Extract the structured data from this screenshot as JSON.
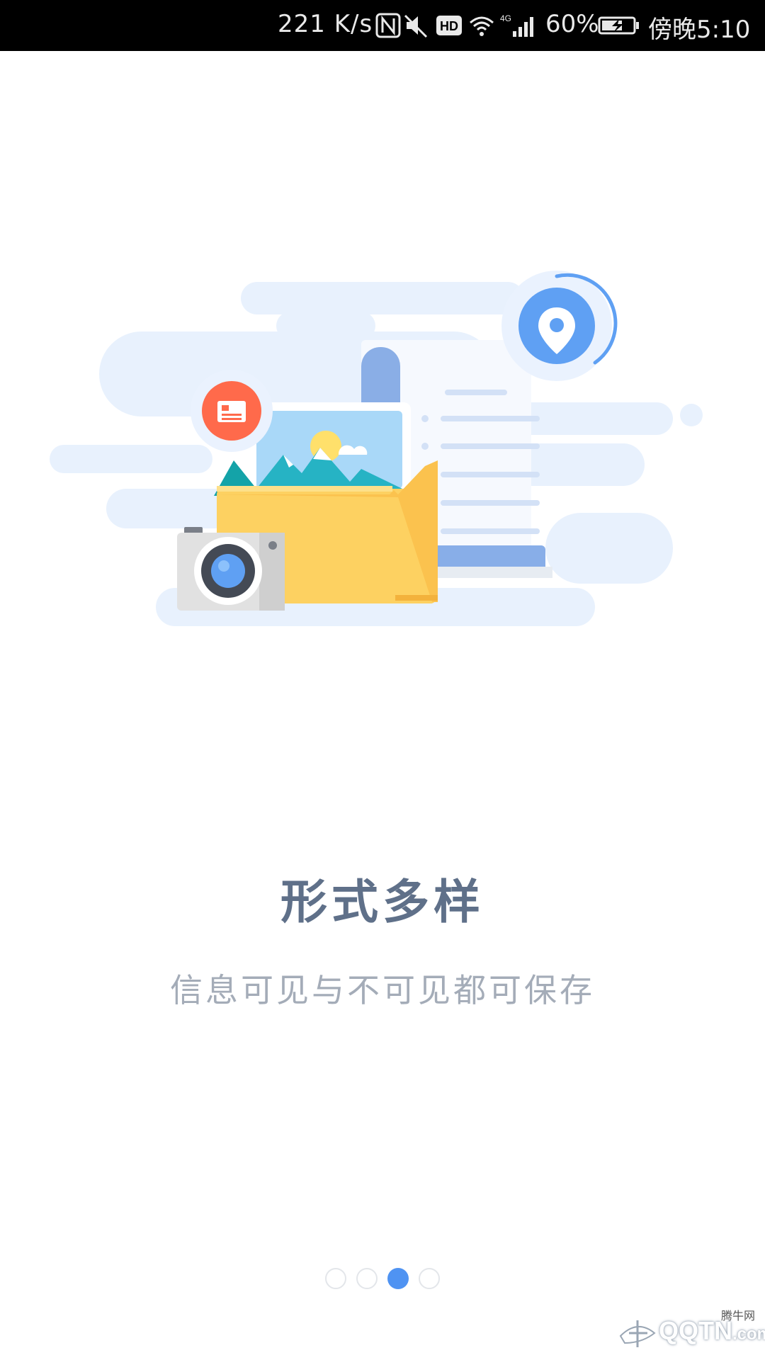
{
  "status_bar": {
    "net_speed": "221 K/s",
    "battery_percent": "60%",
    "time": "傍晚5:10",
    "icons": [
      "nfc-icon",
      "mute-icon",
      "hd-icon",
      "wifi-icon",
      "signal-4g-icon",
      "battery-charging-icon"
    ]
  },
  "onboarding": {
    "title": "形式多样",
    "subtitle": "信息可见与不可见都可保存",
    "page_count": 4,
    "current_page": 3
  },
  "watermark": {
    "text": "QQTN",
    "suffix": ".com",
    "small": "腾牛网"
  },
  "colors": {
    "title": "#5f7089",
    "subtitle": "#a4acb8",
    "dot_active": "#4f93f2",
    "cloud": "#e8f1fd"
  }
}
